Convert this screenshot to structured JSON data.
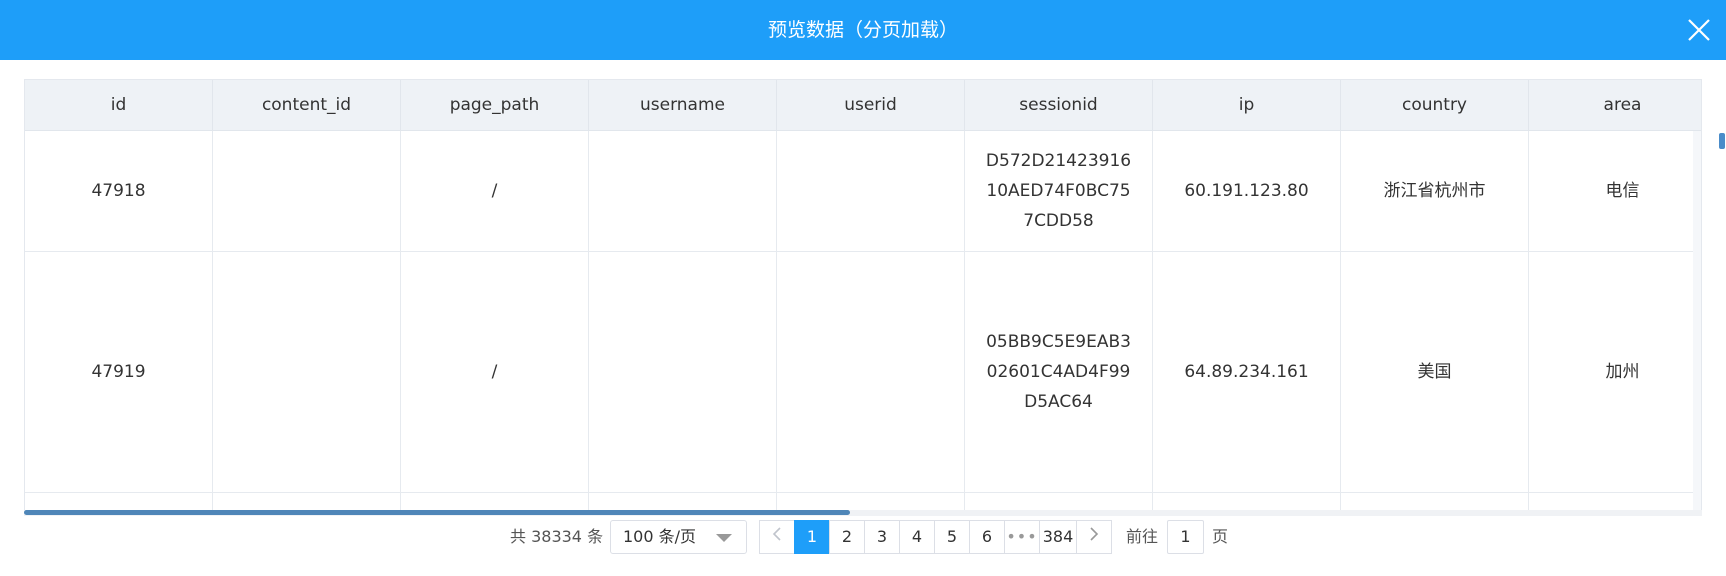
{
  "dialog": {
    "title": "预览数据（分页加载）",
    "close_icon": "close-icon"
  },
  "table": {
    "columns": [
      "id",
      "content_id",
      "page_path",
      "username",
      "userid",
      "sessionid",
      "ip",
      "country",
      "area"
    ],
    "rows": [
      {
        "id": "47918",
        "content_id": "",
        "page_path": "/",
        "username": "",
        "userid": "",
        "sessionid": "D572D2142391610AED74F0BC757CDD58",
        "ip": "60.191.123.80",
        "country": "浙江省杭州市",
        "area": "电信"
      },
      {
        "id": "47919",
        "content_id": "",
        "page_path": "/",
        "username": "",
        "userid": "",
        "sessionid": "05BB9C5E9EAB302601C4AD4F99D5AC64",
        "ip": "64.89.234.161",
        "country": "美国",
        "area": "加州"
      },
      {
        "id": "",
        "content_id": "",
        "page_path": "",
        "username": "",
        "userid": "",
        "sessionid": "",
        "ip": "",
        "country": "",
        "area": ""
      }
    ]
  },
  "pagination": {
    "total": "共 38334 条",
    "page_size": "100 条/页",
    "pages": [
      "1",
      "2",
      "3",
      "4",
      "5",
      "6"
    ],
    "ellipsis": "•••",
    "last_page": "384",
    "current_page": 1,
    "goto_label": "前往",
    "goto_value": "1",
    "goto_unit": "页"
  }
}
